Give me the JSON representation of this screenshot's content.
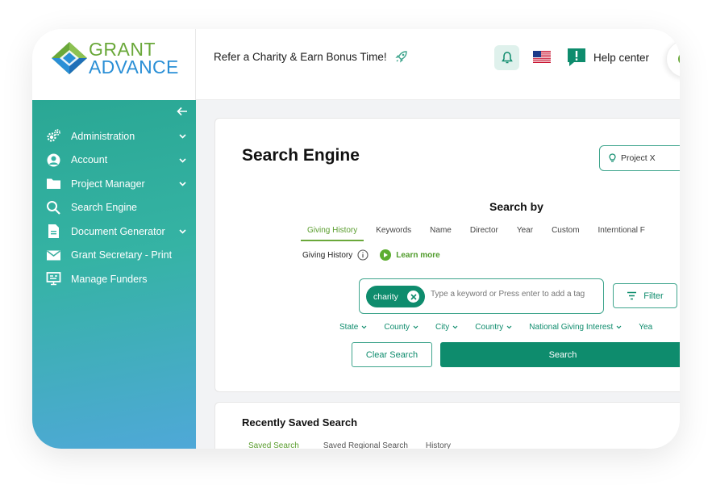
{
  "brand": {
    "line1": "GRANT",
    "line2": "ADVANCE",
    "colors": {
      "green": "#6aa83a",
      "blue": "#2a8fd6",
      "teal": "#0e8c6d"
    }
  },
  "header": {
    "refer_text": "Refer a Charity & Earn Bonus Time!",
    "help_label": "Help center"
  },
  "sidebar": {
    "items": [
      {
        "label": "Administration",
        "icon": "gears-icon",
        "has_chevron": true
      },
      {
        "label": "Account",
        "icon": "user-circle-icon",
        "has_chevron": true
      },
      {
        "label": "Project Manager",
        "icon": "folder-icon",
        "has_chevron": true
      },
      {
        "label": "Search Engine",
        "icon": "search-icon",
        "has_chevron": false
      },
      {
        "label": "Document Generator",
        "icon": "document-icon",
        "has_chevron": true
      },
      {
        "label": "Grant Secretary - Print",
        "icon": "mail-icon",
        "has_chevron": false
      },
      {
        "label": "Manage Funders",
        "icon": "monitor-icon",
        "has_chevron": false
      }
    ]
  },
  "main": {
    "title": "Search Engine",
    "project_label": "Project X",
    "search_by_label": "Search by",
    "tabs": [
      "Giving History",
      "Keywords",
      "Name",
      "Director",
      "Year",
      "Custom",
      "Interntional F"
    ],
    "active_tab": 0,
    "giving_history_label": "Giving History",
    "learn_more": "Learn more",
    "chip_label": "charity",
    "tag_placeholder": "Type a keyword or Press enter to add a tag",
    "filter_label": "Filter",
    "filters": [
      "State",
      "County",
      "City",
      "Country",
      "National Giving Interest",
      "Yea"
    ],
    "clear_search": "Clear Search",
    "search_button": "Search"
  },
  "recent": {
    "title": "Recently Saved Search",
    "tabs": [
      "Saved Search",
      "Saved Regional Search",
      "History"
    ]
  }
}
